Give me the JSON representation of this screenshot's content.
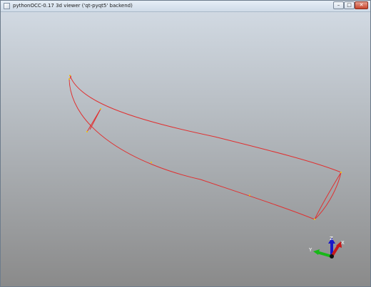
{
  "window": {
    "title": "pythonOCC-0.17 3d viewer ('qt-pyqt5' backend)",
    "controls": {
      "minimize": "–",
      "maximize": "□",
      "close": "✕"
    }
  },
  "viewer": {
    "edge_color": "#e03030",
    "vertex_color": "#e8c020",
    "background_top": "#d1d9e2",
    "background_bottom": "#8a8a8a"
  },
  "triedron": {
    "x_label": "X",
    "y_label": "Y",
    "z_label": "Z",
    "x_color": "#c81818",
    "y_color": "#18b818",
    "z_color": "#1818c8"
  }
}
